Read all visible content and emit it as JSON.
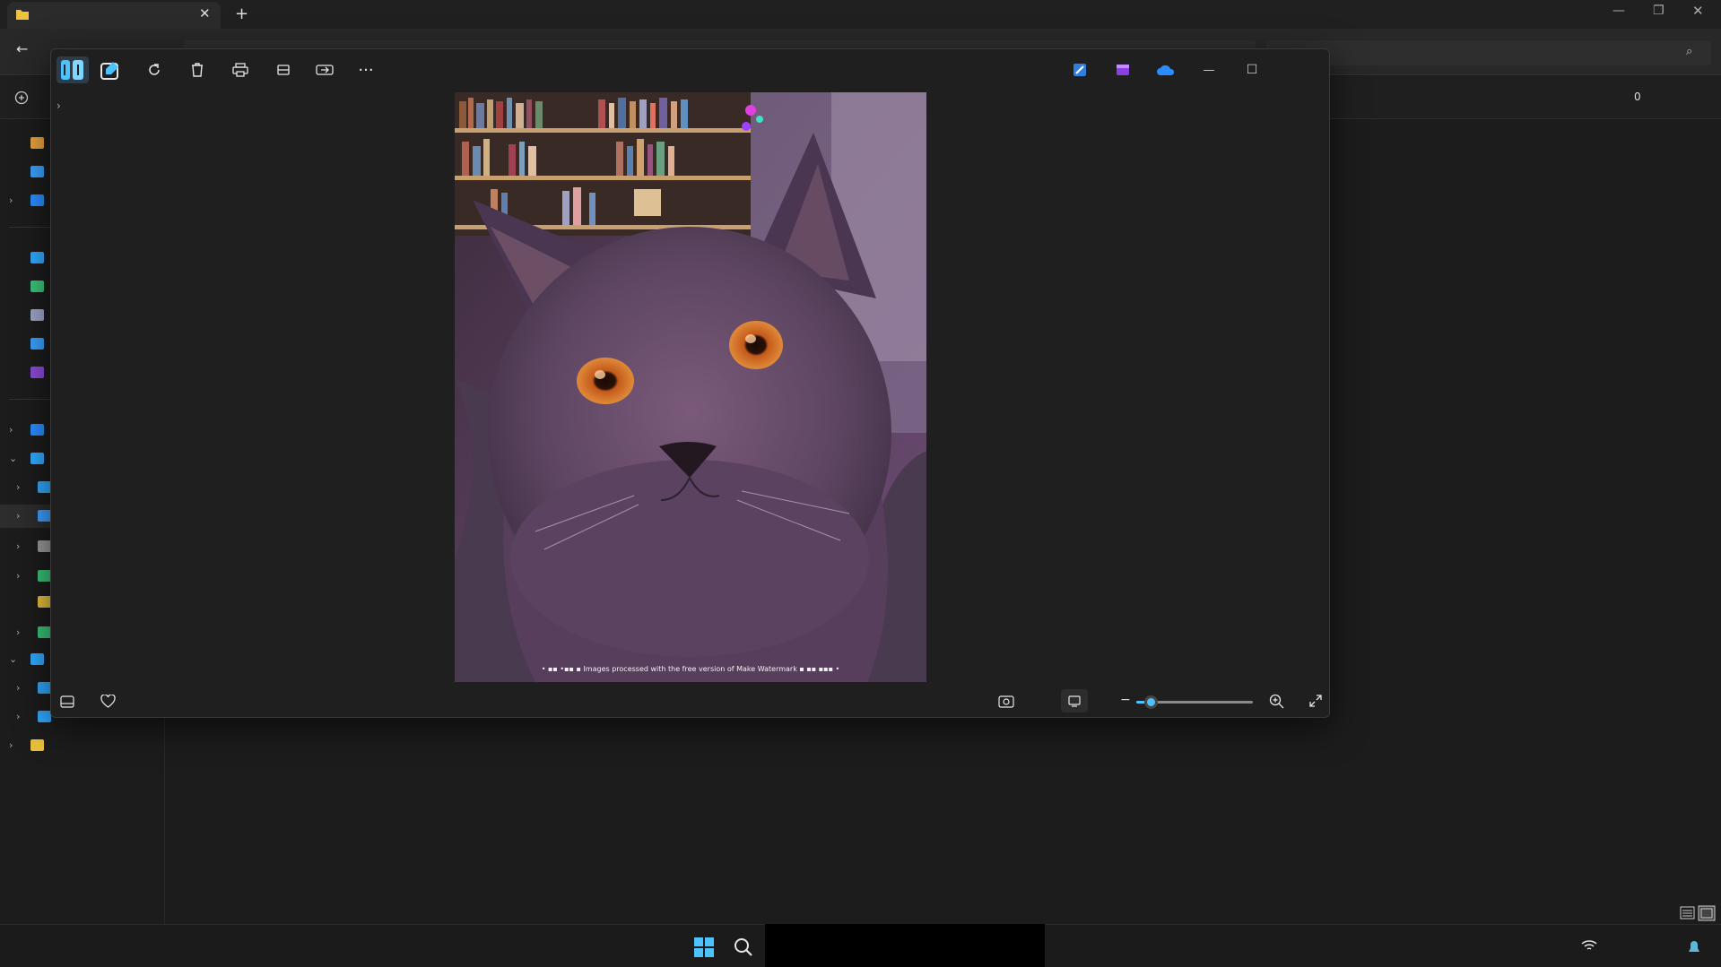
{
  "explorer": {
    "tab_title": "",
    "address_text": "",
    "search_placeholder": "",
    "selection_count": "0",
    "sidebar": {
      "items": [
        {
          "label": "",
          "icon": "home-icon",
          "color": "#e8a13d"
        },
        {
          "label": "",
          "icon": "gallery-icon",
          "color": "#3aa0ff"
        },
        {
          "label": "",
          "icon": "onedrive-icon",
          "color": "#2a8cff"
        },
        {
          "label": "",
          "icon": "desktop-icon",
          "color": "#2fa9ff"
        },
        {
          "label": "",
          "icon": "downloads-icon",
          "color": "#3ac47a"
        },
        {
          "label": "",
          "icon": "documents-icon",
          "color": "#9aa6c8"
        },
        {
          "label": "",
          "icon": "pictures-icon",
          "color": "#3aa0ff"
        },
        {
          "label": "",
          "icon": "videos-icon",
          "color": "#8a4bd8"
        },
        {
          "label": "",
          "icon": "onedrive-icon",
          "color": "#2a8cff"
        },
        {
          "label": "",
          "icon": "this-pc-icon",
          "color": "#2fa9ff"
        },
        {
          "label": "",
          "icon": "desktop-icon",
          "color": "#2fa9ff"
        },
        {
          "label": "",
          "icon": "drive-icon",
          "color": "#3aa0ff"
        },
        {
          "label": "",
          "icon": "drive-icon",
          "color": "#9a9a9a"
        },
        {
          "label": "",
          "icon": "network-drive-icon",
          "color": "#3ac47a"
        },
        {
          "label": "",
          "icon": "network-drive-icon",
          "color": "#e8c13d"
        },
        {
          "label": "",
          "icon": "network-drive-icon",
          "color": "#3ac47a"
        },
        {
          "label": "",
          "icon": "network-icon",
          "color": "#2fa9ff"
        },
        {
          "label": "",
          "icon": "computer-icon",
          "color": "#2fa9ff"
        },
        {
          "label": "",
          "icon": "computer-icon",
          "color": "#2fa9ff"
        },
        {
          "label": "",
          "icon": "linux-icon",
          "color": "#e8c13d"
        }
      ]
    }
  },
  "photos": {
    "toolbar_icons": [
      "edit-image-icon",
      "draw-icon",
      "rotate-icon",
      "delete-icon",
      "print-icon",
      "crop-icon",
      "share-icon",
      "more-icon"
    ],
    "right_icons": [
      "clipchamp-icon",
      "video-editor-icon",
      "onedrive-icon"
    ],
    "image_caption": "• ▪▪ •▪▪ ▪  Images processed with the free version of Make Watermark ▪ ▪▪ ▪▪▪ •",
    "image_description": "gray cat portrait",
    "zoom_level": 0.12,
    "accent": "#4cc2ff"
  },
  "taskbar": {
    "start_icon": "windows-start-icon",
    "search_icon": "search-icon",
    "tray_icons": [
      "network-icon",
      "wifi-icon"
    ]
  }
}
